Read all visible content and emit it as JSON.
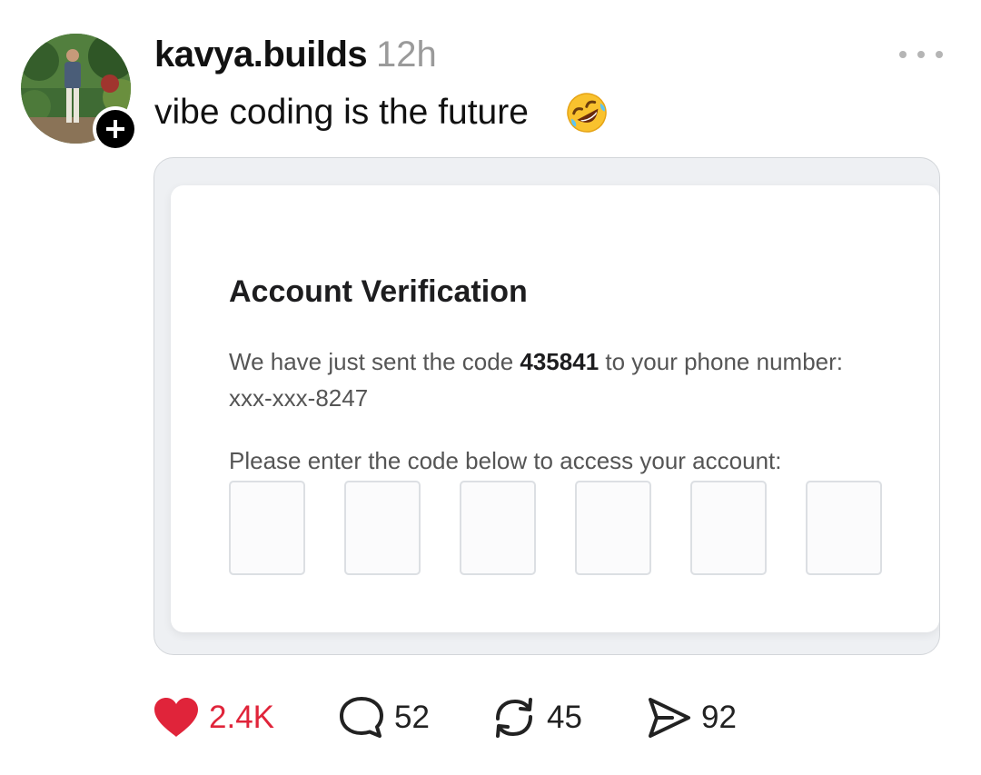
{
  "post": {
    "username": "kavya.builds",
    "timestamp": "12h",
    "text": "vibe coding is the future",
    "emoji_icon": "rolling-on-floor-laughing-emoji"
  },
  "embedded_screenshot": {
    "title": "Account Verification",
    "message_before_code": "We have just sent the code ",
    "code": "435841",
    "message_after_code": " to your phone number: xxx-xxx-8247",
    "instruction": "Please enter the code below to access your account:",
    "code_boxes": [
      "",
      "",
      "",
      "",
      "",
      ""
    ]
  },
  "actions": {
    "likes": "2.4K",
    "comments": "52",
    "reposts": "45",
    "shares": "92"
  },
  "colors": {
    "like": "#e0243a",
    "text": "#111111",
    "muted": "#9a9a9a"
  }
}
